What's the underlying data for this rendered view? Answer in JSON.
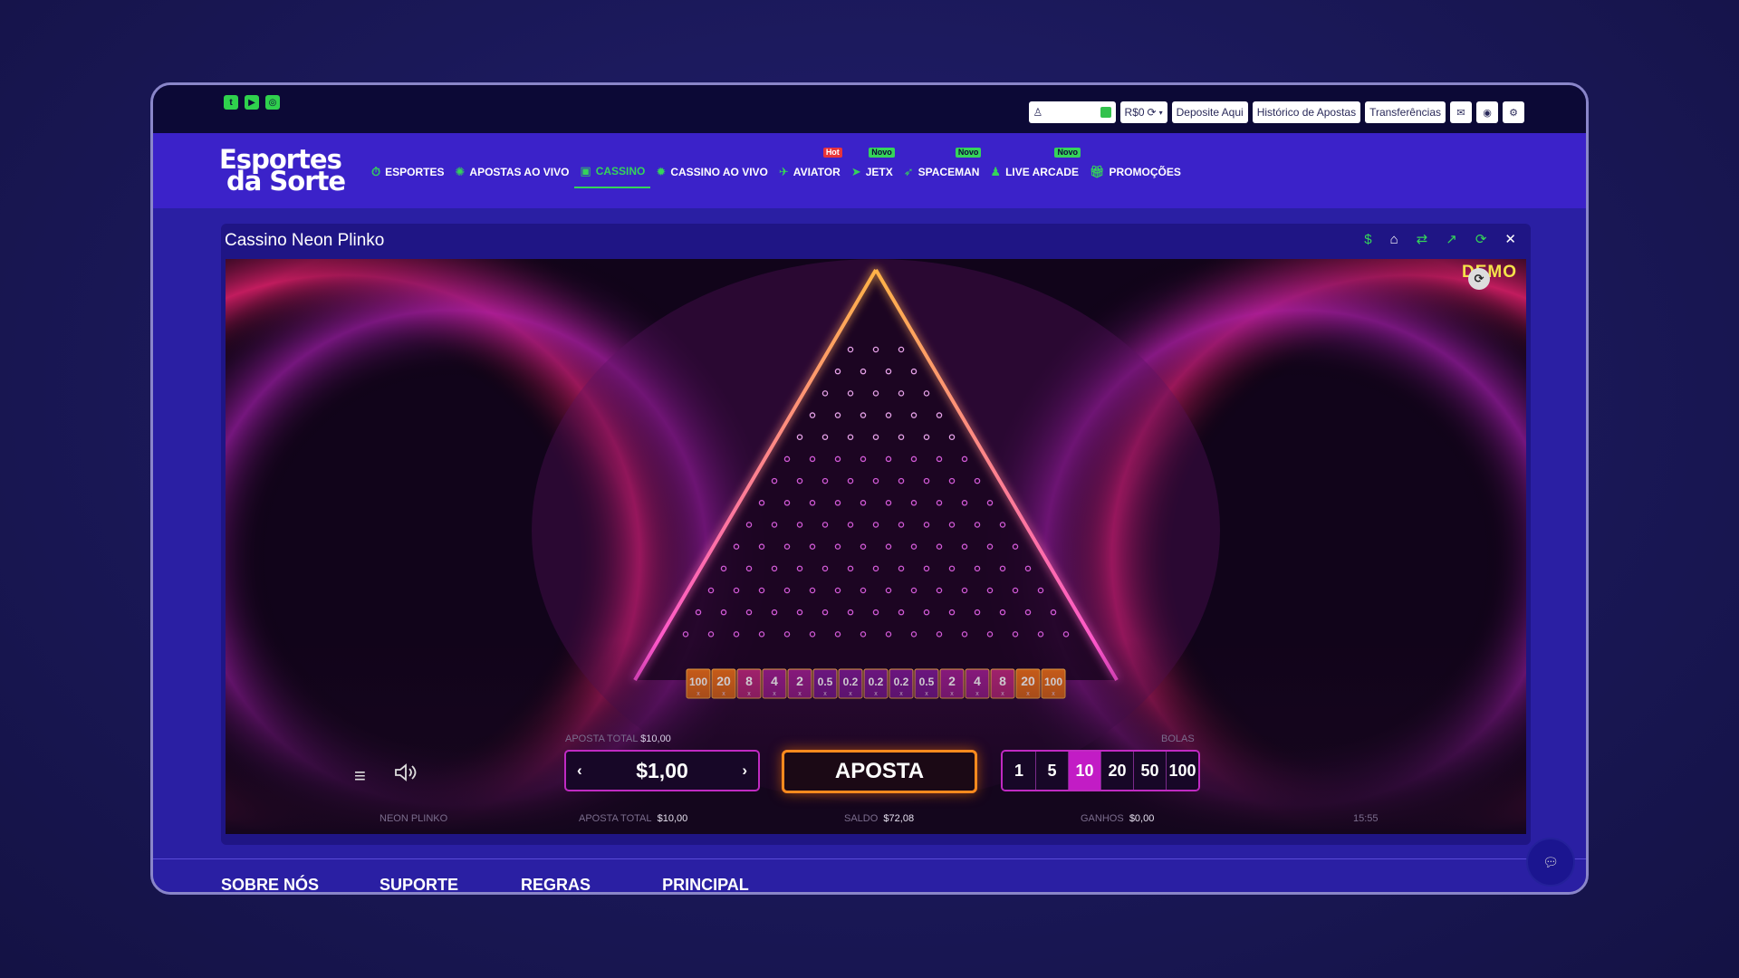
{
  "socials": [
    "twitter-icon",
    "youtube-icon",
    "instagram-icon"
  ],
  "top_controls": {
    "currency": "R$0",
    "deposit_label": "Deposite Aqui",
    "history_label": "Histórico de Apostas",
    "transfers_label": "Transferências"
  },
  "logo": {
    "line1": "Esportes",
    "line2": "da Sorte"
  },
  "nav": [
    {
      "label": "ESPORTES",
      "icon": "stopwatch-icon",
      "badge": ""
    },
    {
      "label": "APOSTAS AO VIVO",
      "icon": "live-icon",
      "badge": ""
    },
    {
      "label": "CASSINO",
      "icon": "slot-icon",
      "badge": "",
      "active": true
    },
    {
      "label": "CASSINO AO VIVO",
      "icon": "gear-icon",
      "badge": ""
    },
    {
      "label": "AVIATOR",
      "icon": "plane-icon",
      "badge": "Hot"
    },
    {
      "label": "JETX",
      "icon": "jet-icon",
      "badge": "Novo"
    },
    {
      "label": "SPACEMAN",
      "icon": "rocket-icon",
      "badge": "Novo"
    },
    {
      "label": "LIVE ARCADE",
      "icon": "joystick-icon",
      "badge": "Novo"
    },
    {
      "label": "PROMOÇÕES",
      "icon": "gift-icon",
      "badge": ""
    }
  ],
  "game": {
    "title": "Cassino Neon Plinko",
    "demo_label": "DEMO",
    "multipliers": [
      "100",
      "20",
      "8",
      "4",
      "2",
      "0.5",
      "0.2",
      "0.2",
      "0.2",
      "0.5",
      "2",
      "4",
      "8",
      "20",
      "100"
    ],
    "multiplier_suffix": "x",
    "aposta_total_label": "APOSTA TOTAL",
    "aposta_total_value": "$10,00",
    "bet_value": "$1,00",
    "aposta_button": "APOSTA",
    "bolas_label": "BOLAS",
    "bolas": [
      "1",
      "5",
      "10",
      "20",
      "50",
      "100"
    ],
    "bolas_selected": "10",
    "game_name": "NEON PLINKO",
    "footer_aposta_label": "APOSTA TOTAL",
    "footer_aposta_value": "$10,00",
    "saldo_label": "SALDO",
    "saldo_value": "$72,08",
    "ganhos_label": "GANHOS",
    "ganhos_value": "$0,00",
    "time": "15:55"
  },
  "footer_nav": [
    "SOBRE NÓS",
    "SUPORTE",
    "REGRAS",
    "PRINCIPAL"
  ],
  "colors": {
    "brand_purple": "#3b22c9",
    "accent_green": "#35d45a",
    "neon_pink": "#c02ac2",
    "orange": "#ff8a1e"
  }
}
